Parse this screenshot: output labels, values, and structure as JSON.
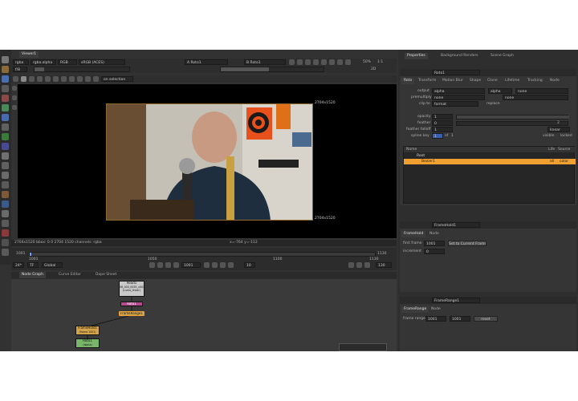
{
  "viewer": {
    "tab": "Viewer1",
    "channels": "rgba",
    "channel_alpha": "rgba.alpha",
    "display_mode": "RGB",
    "colorspace": "sRGB (ACES)",
    "input_a": "A Roto1",
    "input_b": "B Roto1",
    "zoom": "50%",
    "ratio": "1:1",
    "mode": "2D",
    "frame_field": "f/8",
    "frame_count": "1",
    "option_on_selection": "on selection",
    "format_label_top": "2704x1520",
    "format_label_bottom": "2704x1520",
    "info_left": "2704x1520 bbox: 0 0 2704 1520 channels: rgba",
    "info_right": "x=-764 y=-112"
  },
  "timeline": {
    "start": "1001",
    "end": "1130",
    "marks": [
      "1001",
      "1050",
      "1100",
      "1130"
    ],
    "fps_value": "24*",
    "tf": "TF",
    "scope": "Global",
    "current_frame": "1001",
    "step": "10",
    "end_field": "130"
  },
  "nodegraph": {
    "tabs": [
      "Node Graph",
      "Curve Editor",
      "Dope Sheet"
    ],
    "nodes": {
      "read": "Read1",
      "read_file": "08_000_0035_v001_1001.exr",
      "read_sub": "(Luma_linear)",
      "roto": "Roto1",
      "frame_range": "FrameRange1",
      "frame_hold": "FrameHold1",
      "frame_hold_sub": "(frame 1001)",
      "roto2": "Roto1",
      "roto2_sub": "(alpha)"
    }
  },
  "properties": {
    "tabs": [
      "Properties",
      "Background Renders",
      "Scene Graph"
    ],
    "roto": {
      "name": "Roto1",
      "tabs": [
        "Roto",
        "Transform",
        "Motion Blur",
        "Shape",
        "Clone",
        "Lifetime",
        "Tracking",
        "Node"
      ],
      "output_label": "output",
      "output": "alpha",
      "output_ch": "alpha",
      "output_none": "none",
      "premult_label": "premultiply",
      "premult": "none",
      "premult_ch": "none",
      "clip_label": "clip to",
      "clip": "format",
      "replace": "replace",
      "opacity_label": "opacity",
      "opacity": "1",
      "feather_label": "feather",
      "feather": "0",
      "falloff_label": "feather falloff",
      "falloff": "1",
      "falloff_mode": "linear",
      "spline_label": "spline key",
      "spline_key": "1",
      "spline_of": "of",
      "spline_total": "1",
      "visible": "visible",
      "locked": "locked",
      "list_headers": [
        "Name",
        "Life",
        "Source"
      ],
      "items": [
        {
          "name": "Root"
        },
        {
          "name": "Bezier1",
          "life": "all",
          "source": "color"
        }
      ],
      "falloff_step": "2"
    },
    "frame_hold": {
      "name": "FrameHold1",
      "tabs": [
        "FrameHold",
        "Node"
      ],
      "first_label": "first frame",
      "first": "1001",
      "btn": "Set to Current Frame",
      "inc_label": "increment",
      "increment": "0"
    },
    "frame_range": {
      "name": "FrameRange1",
      "tabs": [
        "FrameRange",
        "Node"
      ],
      "range_label": "frame range",
      "from": "1001",
      "to": "1001",
      "reset": "reset"
    }
  },
  "colors": {
    "panel": "#323232",
    "accent": "#f0a030",
    "node_read": "#c8c8c8",
    "node_roto": "#7ab36a",
    "node_hold": "#d2a54c",
    "node_range": "#b74a8f"
  }
}
